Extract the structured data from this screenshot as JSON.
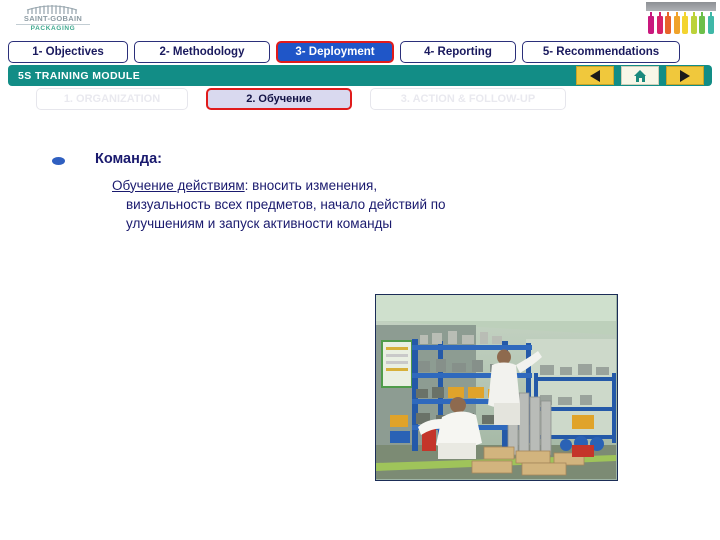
{
  "logo": {
    "brand": "SAINT-GOBAIN",
    "sub": "PACKAGING",
    "icon": "arch-bridge-icon"
  },
  "header_image": {
    "name": "colored-bottles-image",
    "bottle_colors": [
      "#c9187e",
      "#d6216b",
      "#e8632a",
      "#f0a32a",
      "#f3d430",
      "#bcd23a",
      "#6cbf4a",
      "#3fb8a8"
    ]
  },
  "nav_tabs": [
    {
      "label": "1- Objectives",
      "active": false,
      "width_class": "w1"
    },
    {
      "label": "2- Methodology",
      "active": false,
      "width_class": "w2"
    },
    {
      "label": "3- Deployment",
      "active": true,
      "width_class": "w3"
    },
    {
      "label": "4- Reporting",
      "active": false,
      "width_class": "w4"
    },
    {
      "label": "5- Recommendations",
      "active": false,
      "width_class": "w5"
    }
  ],
  "module_bar": {
    "title": "5S TRAINING MODULE",
    "background_color": "#128d86",
    "buttons": [
      {
        "name": "previous-button",
        "icon": "triangle-left-icon"
      },
      {
        "name": "home-button",
        "icon": "house-icon"
      },
      {
        "name": "next-button",
        "icon": "triangle-right-icon"
      }
    ]
  },
  "sub_tabs": [
    {
      "label": "1. ORGANIZATION",
      "current": false,
      "width_class": "s1"
    },
    {
      "label": "2. Обучение",
      "current": true,
      "width_class": "s2"
    },
    {
      "label": "3. ACTION & FOLLOW-UP",
      "current": false,
      "width_class": "s3"
    }
  ],
  "content": {
    "heading": "Команда:",
    "paragraph_underlined": "Обучение действиям",
    "paragraph_rest": ": вносить изменения, визуальность всех предметов, начало действий по улучшениям и запуск активности команды"
  },
  "photo": {
    "name": "warehouse-5s-photo",
    "description": "Two workers in white uniforms organizing parts on blue shelving in a storeroom"
  },
  "colors": {
    "accent_green": "#128d86",
    "active_blue": "#1f56c8",
    "active_red_border": "#e01b1b",
    "text_navy": "#1a1a6e",
    "button_yellow": "#f0c83c"
  }
}
